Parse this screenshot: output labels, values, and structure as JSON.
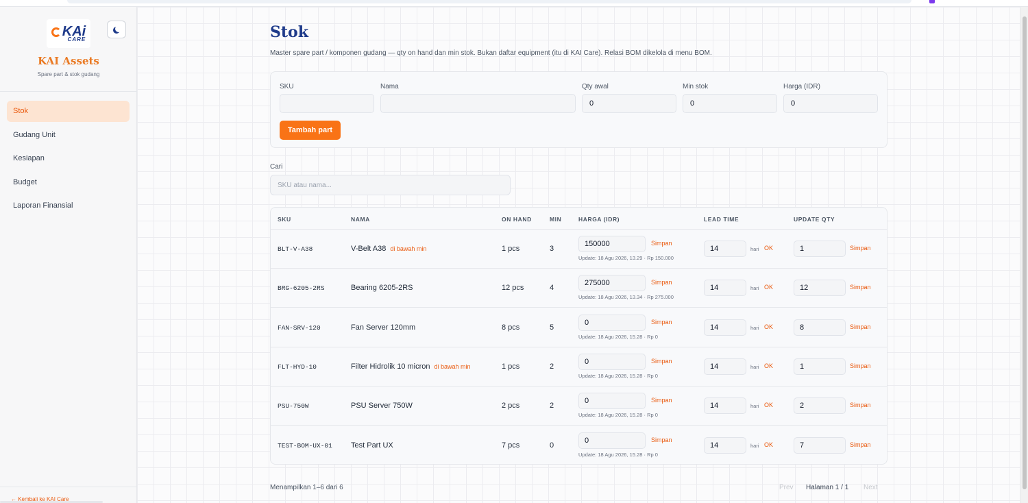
{
  "sidebar": {
    "brand_title": "KAI Assets",
    "brand_subtitle": "Spare part & stok gudang",
    "logo_text": "KAi",
    "logo_subtext": "CARE",
    "items": [
      {
        "label": "Stok",
        "active": true
      },
      {
        "label": "Gudang Unit",
        "active": false
      },
      {
        "label": "Kesiapan",
        "active": false
      },
      {
        "label": "Budget",
        "active": false
      },
      {
        "label": "Laporan Finansial",
        "active": false
      }
    ],
    "back_link": "← Kembali ke KAI Care"
  },
  "page": {
    "title": "Stok",
    "description": "Master spare part / komponen gudang — qty on hand dan min stok. Bukan daftar equipment (itu di KAI Care). Relasi BOM dikelola di menu BOM."
  },
  "form": {
    "sku_label": "SKU",
    "sku_value": "",
    "nama_label": "Nama",
    "nama_value": "",
    "qty_label": "Qty awal",
    "qty_value": "0",
    "min_label": "Min stok",
    "min_value": "0",
    "harga_label": "Harga (IDR)",
    "harga_value": "0",
    "add_button": "Tambah part"
  },
  "search": {
    "label": "Cari",
    "placeholder": "SKU atau nama..."
  },
  "table": {
    "headers": [
      "SKU",
      "NAMA",
      "ON HAND",
      "MIN",
      "HARGA (IDR)",
      "LEAD TIME",
      "UPDATE QTY"
    ],
    "save_label": "Simpan",
    "ok_label": "OK",
    "hari_label": "hari",
    "rows": [
      {
        "sku": "BLT-V-A38",
        "nama": "V-Belt A38",
        "warning": "di bawah min",
        "on_hand": "1 pcs",
        "min": "3",
        "harga": "150000",
        "update": "Update: 18 Agu 2026, 13.29 · Rp 150.000",
        "lead": "14",
        "qty": "1"
      },
      {
        "sku": "BRG-6205-2RS",
        "nama": "Bearing 6205-2RS",
        "warning": "",
        "on_hand": "12 pcs",
        "min": "4",
        "harga": "275000",
        "update": "Update: 18 Agu 2026, 13.34 · Rp 275.000",
        "lead": "14",
        "qty": "12"
      },
      {
        "sku": "FAN-SRV-120",
        "nama": "Fan Server 120mm",
        "warning": "",
        "on_hand": "8 pcs",
        "min": "5",
        "harga": "0",
        "update": "Update: 18 Agu 2026, 15.28 · Rp 0",
        "lead": "14",
        "qty": "8"
      },
      {
        "sku": "FLT-HYD-10",
        "nama": "Filter Hidrolik 10 micron",
        "warning": "di bawah min",
        "on_hand": "1 pcs",
        "min": "2",
        "harga": "0",
        "update": "Update: 18 Agu 2026, 15.28 · Rp 0",
        "lead": "14",
        "qty": "1"
      },
      {
        "sku": "PSU-750W",
        "nama": "PSU Server 750W",
        "warning": "",
        "on_hand": "2 pcs",
        "min": "2",
        "harga": "0",
        "update": "Update: 18 Agu 2026, 15.28 · Rp 0",
        "lead": "14",
        "qty": "2"
      },
      {
        "sku": "TEST-BOM-UX-01",
        "nama": "Test Part UX",
        "warning": "",
        "on_hand": "7 pcs",
        "min": "0",
        "harga": "0",
        "update": "Update: 18 Agu 2026, 15.28 · Rp 0",
        "lead": "14",
        "qty": "7"
      }
    ]
  },
  "pagination": {
    "showing": "Menampilkan 1–6 dari 6",
    "prev": "Prev",
    "info": "Halaman 1 / 1",
    "next": "Next"
  },
  "colors": {
    "accent": "#f97316",
    "brand_blue": "#1e3a8a",
    "warning": "#ea580c"
  }
}
